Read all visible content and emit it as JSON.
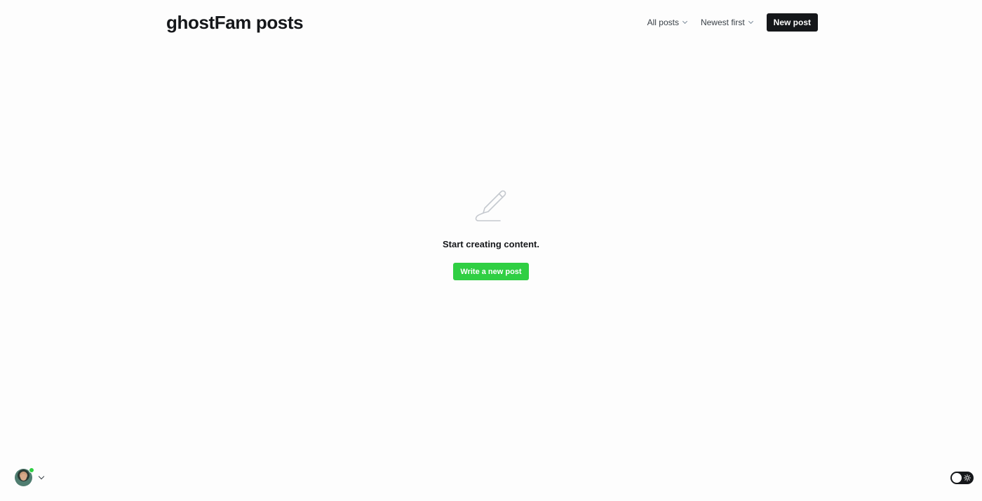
{
  "header": {
    "title": "ghostFam posts",
    "filters": {
      "type_label": "All posts",
      "sort_label": "Newest first"
    },
    "new_post_label": "New post"
  },
  "empty_state": {
    "icon": "pen-icon",
    "message": "Start creating content.",
    "button_label": "Write a new post"
  },
  "footer": {
    "user_icon": "avatar",
    "status": "online",
    "theme_toggle_icon": "sun-icon",
    "theme_mode": "light"
  },
  "colors": {
    "accent": "#30cf43",
    "primary_button": "#15171a",
    "background": "#fdfdfd"
  }
}
